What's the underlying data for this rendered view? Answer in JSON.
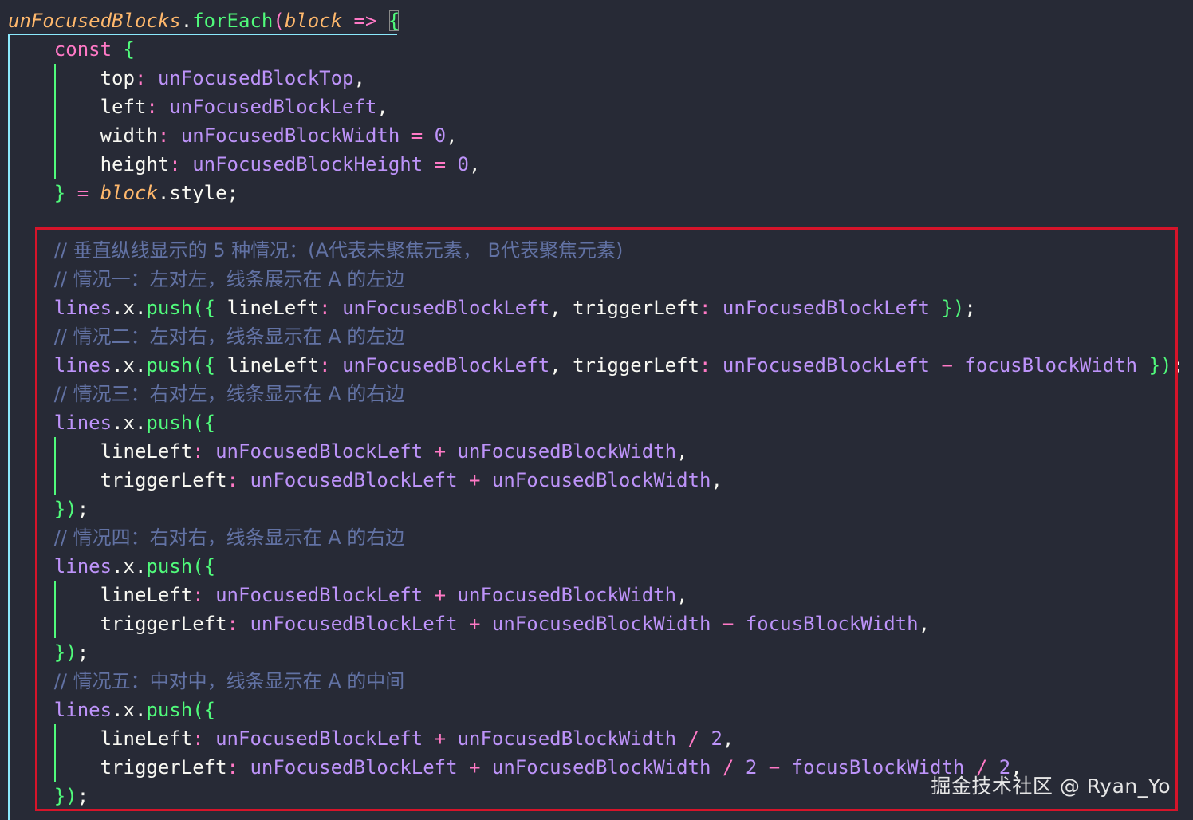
{
  "theme": {
    "background": "#272a36",
    "plain": "#f8f8f2",
    "keyword": "#ff79c6",
    "variable": "#bd93f9",
    "function": "#50fa7b",
    "parameter": "#ffb86c",
    "comment": "#6272a4",
    "box_border": "#d6142a",
    "guide_outer": "#8be9fd",
    "guide_inner": "#50fa7b"
  },
  "code_lines": [
    {
      "indent": 0,
      "tokens": [
        {
          "t": "unFocusedBlocks",
          "c": "parameter",
          "i": true
        },
        {
          "t": ".",
          "c": "plain"
        },
        {
          "t": "forEach",
          "c": "function"
        },
        {
          "t": "(",
          "c": "keyword"
        },
        {
          "t": "block",
          "c": "parameter",
          "i": true
        },
        {
          "t": " => ",
          "c": "keyword"
        },
        {
          "t": "{",
          "c": "function",
          "bracket": true
        }
      ]
    },
    {
      "indent": 2,
      "tokens": [
        {
          "t": "const ",
          "c": "keyword"
        },
        {
          "t": "{",
          "c": "function"
        }
      ]
    },
    {
      "indent": 4,
      "tokens": [
        {
          "t": "top",
          "c": "plain"
        },
        {
          "t": ": ",
          "c": "keyword"
        },
        {
          "t": "unFocusedBlockTop",
          "c": "variable"
        },
        {
          "t": ",",
          "c": "plain"
        }
      ]
    },
    {
      "indent": 4,
      "tokens": [
        {
          "t": "left",
          "c": "plain"
        },
        {
          "t": ": ",
          "c": "keyword"
        },
        {
          "t": "unFocusedBlockLeft",
          "c": "variable"
        },
        {
          "t": ",",
          "c": "plain"
        }
      ]
    },
    {
      "indent": 4,
      "tokens": [
        {
          "t": "width",
          "c": "plain"
        },
        {
          "t": ": ",
          "c": "keyword"
        },
        {
          "t": "unFocusedBlockWidth",
          "c": "variable"
        },
        {
          "t": " = ",
          "c": "keyword"
        },
        {
          "t": "0",
          "c": "variable"
        },
        {
          "t": ",",
          "c": "plain"
        }
      ]
    },
    {
      "indent": 4,
      "tokens": [
        {
          "t": "height",
          "c": "plain"
        },
        {
          "t": ": ",
          "c": "keyword"
        },
        {
          "t": "unFocusedBlockHeight",
          "c": "variable"
        },
        {
          "t": " = ",
          "c": "keyword"
        },
        {
          "t": "0",
          "c": "variable"
        },
        {
          "t": ",",
          "c": "plain"
        }
      ]
    },
    {
      "indent": 2,
      "tokens": [
        {
          "t": "}",
          "c": "function"
        },
        {
          "t": " = ",
          "c": "keyword"
        },
        {
          "t": "block",
          "c": "parameter",
          "i": true
        },
        {
          "t": ".style;",
          "c": "plain"
        }
      ]
    },
    {
      "indent": 0,
      "tokens": []
    },
    {
      "indent": 2,
      "tokens": [
        {
          "t": "// 垂直纵线显示的 5 种情况：(A代表未聚焦元素， B代表聚焦元素)",
          "c": "comment",
          "cjk": true
        }
      ]
    },
    {
      "indent": 2,
      "tokens": [
        {
          "t": "// 情况一：左对左，线条展示在 A 的左边",
          "c": "comment",
          "cjk": true
        }
      ]
    },
    {
      "indent": 2,
      "tokens": [
        {
          "t": "lines",
          "c": "variable"
        },
        {
          "t": ".x.",
          "c": "plain"
        },
        {
          "t": "push",
          "c": "function"
        },
        {
          "t": "({ ",
          "c": "function"
        },
        {
          "t": "lineLeft",
          "c": "plain"
        },
        {
          "t": ": ",
          "c": "keyword"
        },
        {
          "t": "unFocusedBlockLeft",
          "c": "variable"
        },
        {
          "t": ", ",
          "c": "plain"
        },
        {
          "t": "triggerLeft",
          "c": "plain"
        },
        {
          "t": ": ",
          "c": "keyword"
        },
        {
          "t": "unFocusedBlockLeft",
          "c": "variable"
        },
        {
          "t": " })",
          "c": "function"
        },
        {
          "t": ";",
          "c": "plain"
        }
      ]
    },
    {
      "indent": 2,
      "tokens": [
        {
          "t": "// 情况二：左对右，线条显示在 A 的左边",
          "c": "comment",
          "cjk": true
        }
      ]
    },
    {
      "indent": 2,
      "tokens": [
        {
          "t": "lines",
          "c": "variable"
        },
        {
          "t": ".x.",
          "c": "plain"
        },
        {
          "t": "push",
          "c": "function"
        },
        {
          "t": "({ ",
          "c": "function"
        },
        {
          "t": "lineLeft",
          "c": "plain"
        },
        {
          "t": ": ",
          "c": "keyword"
        },
        {
          "t": "unFocusedBlockLeft",
          "c": "variable"
        },
        {
          "t": ", ",
          "c": "plain"
        },
        {
          "t": "triggerLeft",
          "c": "plain"
        },
        {
          "t": ": ",
          "c": "keyword"
        },
        {
          "t": "unFocusedBlockLeft",
          "c": "variable"
        },
        {
          "t": " − ",
          "c": "keyword"
        },
        {
          "t": "focusBlockWidth",
          "c": "variable"
        },
        {
          "t": " })",
          "c": "function"
        },
        {
          "t": ";",
          "c": "plain"
        }
      ]
    },
    {
      "indent": 2,
      "tokens": [
        {
          "t": "// 情况三：右对左，线条显示在 A 的右边",
          "c": "comment",
          "cjk": true
        }
      ]
    },
    {
      "indent": 2,
      "tokens": [
        {
          "t": "lines",
          "c": "variable"
        },
        {
          "t": ".x.",
          "c": "plain"
        },
        {
          "t": "push",
          "c": "function"
        },
        {
          "t": "({",
          "c": "function"
        }
      ]
    },
    {
      "indent": 4,
      "tokens": [
        {
          "t": "lineLeft",
          "c": "plain"
        },
        {
          "t": ": ",
          "c": "keyword"
        },
        {
          "t": "unFocusedBlockLeft",
          "c": "variable"
        },
        {
          "t": " + ",
          "c": "keyword"
        },
        {
          "t": "unFocusedBlockWidth",
          "c": "variable"
        },
        {
          "t": ",",
          "c": "plain"
        }
      ]
    },
    {
      "indent": 4,
      "tokens": [
        {
          "t": "triggerLeft",
          "c": "plain"
        },
        {
          "t": ": ",
          "c": "keyword"
        },
        {
          "t": "unFocusedBlockLeft",
          "c": "variable"
        },
        {
          "t": " + ",
          "c": "keyword"
        },
        {
          "t": "unFocusedBlockWidth",
          "c": "variable"
        },
        {
          "t": ",",
          "c": "plain"
        }
      ]
    },
    {
      "indent": 2,
      "tokens": [
        {
          "t": "})",
          "c": "function"
        },
        {
          "t": ";",
          "c": "plain"
        }
      ]
    },
    {
      "indent": 2,
      "tokens": [
        {
          "t": "// 情况四：右对右，线条显示在 A 的右边",
          "c": "comment",
          "cjk": true
        }
      ]
    },
    {
      "indent": 2,
      "tokens": [
        {
          "t": "lines",
          "c": "variable"
        },
        {
          "t": ".x.",
          "c": "plain"
        },
        {
          "t": "push",
          "c": "function"
        },
        {
          "t": "({",
          "c": "function"
        }
      ]
    },
    {
      "indent": 4,
      "tokens": [
        {
          "t": "lineLeft",
          "c": "plain"
        },
        {
          "t": ": ",
          "c": "keyword"
        },
        {
          "t": "unFocusedBlockLeft",
          "c": "variable"
        },
        {
          "t": " + ",
          "c": "keyword"
        },
        {
          "t": "unFocusedBlockWidth",
          "c": "variable"
        },
        {
          "t": ",",
          "c": "plain"
        }
      ]
    },
    {
      "indent": 4,
      "tokens": [
        {
          "t": "triggerLeft",
          "c": "plain"
        },
        {
          "t": ": ",
          "c": "keyword"
        },
        {
          "t": "unFocusedBlockLeft",
          "c": "variable"
        },
        {
          "t": " + ",
          "c": "keyword"
        },
        {
          "t": "unFocusedBlockWidth",
          "c": "variable"
        },
        {
          "t": " − ",
          "c": "keyword"
        },
        {
          "t": "focusBlockWidth",
          "c": "variable"
        },
        {
          "t": ",",
          "c": "plain"
        }
      ]
    },
    {
      "indent": 2,
      "tokens": [
        {
          "t": "})",
          "c": "function"
        },
        {
          "t": ";",
          "c": "plain"
        }
      ]
    },
    {
      "indent": 2,
      "tokens": [
        {
          "t": "// 情况五：中对中，线条显示在 A 的中间",
          "c": "comment",
          "cjk": true
        }
      ]
    },
    {
      "indent": 2,
      "tokens": [
        {
          "t": "lines",
          "c": "variable"
        },
        {
          "t": ".x.",
          "c": "plain"
        },
        {
          "t": "push",
          "c": "function"
        },
        {
          "t": "({",
          "c": "function"
        }
      ]
    },
    {
      "indent": 4,
      "tokens": [
        {
          "t": "lineLeft",
          "c": "plain"
        },
        {
          "t": ": ",
          "c": "keyword"
        },
        {
          "t": "unFocusedBlockLeft",
          "c": "variable"
        },
        {
          "t": " + ",
          "c": "keyword"
        },
        {
          "t": "unFocusedBlockWidth",
          "c": "variable"
        },
        {
          "t": " / ",
          "c": "keyword"
        },
        {
          "t": "2",
          "c": "variable"
        },
        {
          "t": ",",
          "c": "plain"
        }
      ]
    },
    {
      "indent": 4,
      "tokens": [
        {
          "t": "triggerLeft",
          "c": "plain"
        },
        {
          "t": ": ",
          "c": "keyword"
        },
        {
          "t": "unFocusedBlockLeft",
          "c": "variable"
        },
        {
          "t": " + ",
          "c": "keyword"
        },
        {
          "t": "unFocusedBlockWidth",
          "c": "variable"
        },
        {
          "t": " / ",
          "c": "keyword"
        },
        {
          "t": "2",
          "c": "variable"
        },
        {
          "t": " − ",
          "c": "keyword"
        },
        {
          "t": "focusBlockWidth",
          "c": "variable"
        },
        {
          "t": " / ",
          "c": "keyword"
        },
        {
          "t": "2",
          "c": "variable"
        },
        {
          "t": ",",
          "c": "plain"
        }
      ]
    },
    {
      "indent": 2,
      "tokens": [
        {
          "t": "})",
          "c": "function"
        },
        {
          "t": ";",
          "c": "plain"
        }
      ]
    }
  ],
  "watermark": {
    "text": "掘金技术社区 @ Ryan_Yo"
  }
}
